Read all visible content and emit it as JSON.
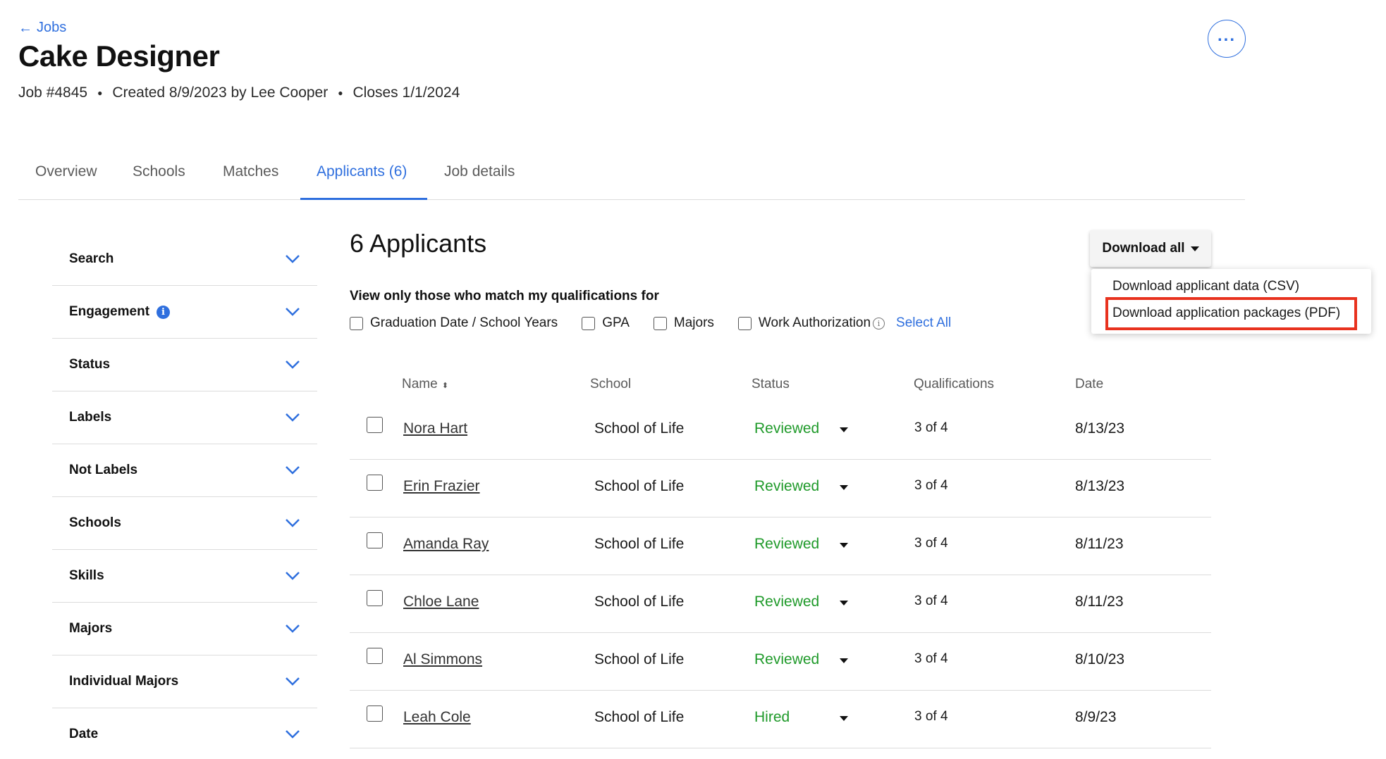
{
  "header": {
    "back_label": "Jobs",
    "title": "Cake Designer",
    "job_number": "Job #4845",
    "created": "Created 8/9/2023 by Lee Cooper",
    "closes": "Closes 1/1/2024"
  },
  "tabs": [
    {
      "label": "Overview"
    },
    {
      "label": "Schools"
    },
    {
      "label": "Matches"
    },
    {
      "label": "Applicants (6)"
    },
    {
      "label": "Job details"
    }
  ],
  "sidebar": {
    "filters": [
      {
        "label": "Search"
      },
      {
        "label": "Engagement"
      },
      {
        "label": "Status"
      },
      {
        "label": "Labels"
      },
      {
        "label": "Not Labels"
      },
      {
        "label": "Schools"
      },
      {
        "label": "Skills"
      },
      {
        "label": "Majors"
      },
      {
        "label": "Individual Majors"
      },
      {
        "label": "Date"
      }
    ]
  },
  "main": {
    "title": "6 Applicants",
    "download_button": "Download all",
    "download_menu": {
      "csv": "Download applicant data (CSV)",
      "pdf": "Download application packages (PDF)"
    },
    "qualifications_label": "View only those who match my qualifications for",
    "qualifications": [
      {
        "label": "Graduation Date / School Years"
      },
      {
        "label": "GPA"
      },
      {
        "label": "Majors"
      },
      {
        "label": "Work Authorization"
      }
    ],
    "select_all": "Select All"
  },
  "table": {
    "columns": [
      "Name",
      "School",
      "Status",
      "Qualifications",
      "Date"
    ],
    "rows": [
      {
        "name": "Nora Hart",
        "school": "School of Life",
        "status": "Reviewed",
        "qualifications": "3 of 4",
        "date": "8/13/23"
      },
      {
        "name": "Erin Frazier",
        "school": "School of Life",
        "status": "Reviewed",
        "qualifications": "3 of 4",
        "date": "8/13/23"
      },
      {
        "name": "Amanda Ray",
        "school": "School of Life",
        "status": "Reviewed",
        "qualifications": "3 of 4",
        "date": "8/11/23"
      },
      {
        "name": "Chloe Lane",
        "school": "School of Life",
        "status": "Reviewed",
        "qualifications": "3 of 4",
        "date": "8/11/23"
      },
      {
        "name": "Al Simmons",
        "school": "School of Life",
        "status": "Reviewed",
        "qualifications": "3 of 4",
        "date": "8/10/23"
      },
      {
        "name": "Leah Cole",
        "school": "School of Life",
        "status": "Hired",
        "qualifications": "3 of 4",
        "date": "8/9/23"
      }
    ]
  },
  "colors": {
    "accent": "#2f6fde",
    "status_green": "#1f9a2a",
    "highlight_red": "#e8321e"
  },
  "icons": {
    "back": "arrow-left-icon",
    "more": "ellipsis-icon",
    "filter_toggle": "chevron-down-icon",
    "info": "info-icon",
    "sort": "sort-icon",
    "dropdown": "caret-down-icon"
  }
}
